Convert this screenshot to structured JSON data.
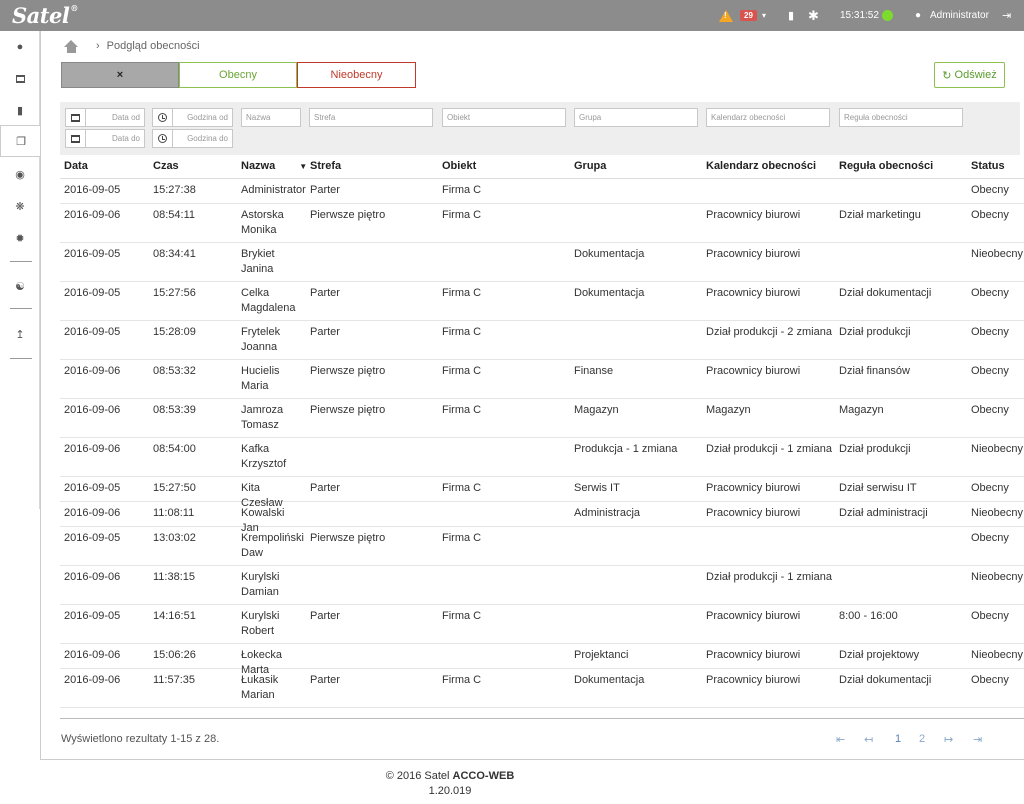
{
  "topbar": {
    "logo": "Satel",
    "logo_mark": "®",
    "alarm_count": "29",
    "time": "15:31:52",
    "user": "Administrator",
    "icons": [
      "warning-icon",
      "chevron-down-icon",
      "unlock-icon",
      "snowflake-icon",
      "user-icon",
      "logout-icon"
    ],
    "status_color": "#7ddb2d"
  },
  "sidebar": {
    "items": [
      "user-icon",
      "calendar-icon",
      "document-icon",
      "copy-icon",
      "globe-icon",
      "cogs-icon",
      "gear-icon",
      "network-icon",
      "upload-icon"
    ]
  },
  "breadcrumb": {
    "page": "Podgląd obecności"
  },
  "filters_top": {
    "clear": "×",
    "present": "Obecny",
    "absent": "Nieobecny",
    "refresh": "Odśwież"
  },
  "filters": {
    "date_from": "Data od",
    "time_from": "Godzina od",
    "date_to": "Data do",
    "time_to": "Godzina do",
    "name": "Nazwa",
    "zone": "Strefa",
    "object": "Obiekt",
    "group": "Grupa",
    "calendar": "Kalendarz obecności",
    "rule": "Reguła obecności"
  },
  "table": {
    "headers": [
      "Data",
      "Czas",
      "Nazwa",
      "Strefa",
      "Obiekt",
      "Grupa",
      "Kalendarz obecności",
      "Reguła obecności",
      "Status"
    ],
    "sort_indicator": "▼",
    "rows": [
      [
        "2016-09-05",
        "15:27:38",
        "Administrator",
        "Parter",
        "Firma C",
        "",
        "",
        "",
        "Obecny"
      ],
      [
        "2016-09-06",
        "08:54:11",
        "Astorska Monika",
        "Pierwsze piętro",
        "Firma C",
        "",
        "Pracownicy biurowi",
        "Dział marketingu",
        "Obecny"
      ],
      [
        "2016-09-05",
        "08:34:41",
        "Brykiet Janina",
        "",
        "",
        "Dokumentacja",
        "Pracownicy biurowi",
        "",
        "Nieobecny"
      ],
      [
        "2016-09-05",
        "15:27:56",
        "Celka Magdalena",
        "Parter",
        "Firma C",
        "Dokumentacja",
        "Pracownicy biurowi",
        "Dział dokumentacji",
        "Obecny"
      ],
      [
        "2016-09-05",
        "15:28:09",
        "Frytelek Joanna",
        "Parter",
        "Firma C",
        "",
        "Dział produkcji - 2 zmiana",
        "Dział produkcji",
        "Obecny"
      ],
      [
        "2016-09-06",
        "08:53:32",
        "Hucielis Maria",
        "Pierwsze piętro",
        "Firma C",
        "Finanse",
        "Pracownicy biurowi",
        "Dział finansów",
        "Obecny"
      ],
      [
        "2016-09-06",
        "08:53:39",
        "Jamroza Tomasz",
        "Pierwsze piętro",
        "Firma C",
        "Magazyn",
        "Magazyn",
        "Magazyn",
        "Obecny"
      ],
      [
        "2016-09-06",
        "08:54:00",
        "Kafka Krzysztof",
        "",
        "",
        "Produkcja - 1 zmiana",
        "Dział produkcji - 1 zmiana",
        "Dział produkcji",
        "Nieobecny"
      ],
      [
        "2016-09-05",
        "15:27:50",
        "Kita Czesław",
        "Parter",
        "Firma C",
        "Serwis IT",
        "Pracownicy biurowi",
        "Dział serwisu IT",
        "Obecny"
      ],
      [
        "2016-09-06",
        "11:08:11",
        "Kowalski Jan",
        "",
        "",
        "Administracja",
        "Pracownicy biurowi",
        "Dział administracji",
        "Nieobecny"
      ],
      [
        "2016-09-05",
        "13:03:02",
        "Krempoliński Daw",
        "Pierwsze piętro",
        "Firma C",
        "",
        "",
        "",
        "Obecny"
      ],
      [
        "2016-09-06",
        "11:38:15",
        "Kurylski Damian",
        "",
        "",
        "",
        "Dział produkcji - 1 zmiana",
        "",
        "Nieobecny"
      ],
      [
        "2016-09-05",
        "14:16:51",
        "Kurylski Robert",
        "Parter",
        "Firma C",
        "",
        "Pracownicy biurowi",
        "8:00 - 16:00",
        "Obecny"
      ],
      [
        "2016-09-06",
        "15:06:26",
        "Łokecka Marta",
        "",
        "",
        "Projektanci",
        "Pracownicy biurowi",
        "Dział projektowy",
        "Nieobecny"
      ],
      [
        "2016-09-06",
        "11:57:35",
        "Łukasik Marian",
        "Parter",
        "Firma C",
        "Dokumentacja",
        "Pracownicy biurowi",
        "Dział dokumentacji",
        "Obecny"
      ]
    ]
  },
  "results_text": "Wyświetlono rezultaty 1-15 z 28.",
  "pagination": {
    "first": "⇤",
    "prev": "↤",
    "page1": "1",
    "page2": "2",
    "next": "↦",
    "last": "⇥"
  },
  "footer": {
    "line1_prefix": "© 2016 Satel ",
    "product": "ACCO-WEB",
    "version": "1.20.019"
  }
}
